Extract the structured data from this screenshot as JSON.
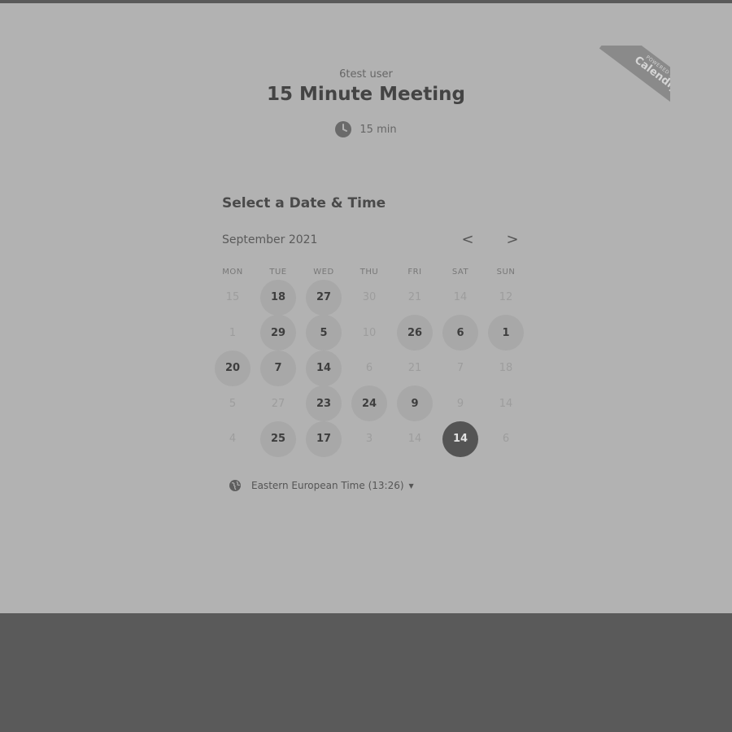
{
  "host_name": "6test user",
  "event_title": "15 Minute Meeting",
  "duration": "15 min",
  "ribbon": {
    "small": "POWERED BY",
    "brand": "Calendly"
  },
  "select_heading": "Select a Date & Time",
  "month_label": "September 2021",
  "nav": {
    "prev": "<",
    "next": ">"
  },
  "weekdays": [
    "MON",
    "TUE",
    "WED",
    "THU",
    "FRI",
    "SAT",
    "SUN"
  ],
  "weeks": [
    [
      {
        "d": "15",
        "s": "unavailable"
      },
      {
        "d": "18",
        "s": "available"
      },
      {
        "d": "27",
        "s": "available"
      },
      {
        "d": "30",
        "s": "unavailable"
      },
      {
        "d": "21",
        "s": "unavailable"
      },
      {
        "d": "14",
        "s": "unavailable"
      },
      {
        "d": "12",
        "s": "unavailable"
      }
    ],
    [
      {
        "d": "1",
        "s": "unavailable"
      },
      {
        "d": "29",
        "s": "available"
      },
      {
        "d": "5",
        "s": "available"
      },
      {
        "d": "10",
        "s": "unavailable"
      },
      {
        "d": "26",
        "s": "available"
      },
      {
        "d": "6",
        "s": "available"
      },
      {
        "d": "1",
        "s": "available"
      }
    ],
    [
      {
        "d": "20",
        "s": "available"
      },
      {
        "d": "7",
        "s": "available"
      },
      {
        "d": "14",
        "s": "available"
      },
      {
        "d": "6",
        "s": "unavailable"
      },
      {
        "d": "21",
        "s": "unavailable"
      },
      {
        "d": "7",
        "s": "unavailable"
      },
      {
        "d": "18",
        "s": "unavailable"
      }
    ],
    [
      {
        "d": "5",
        "s": "unavailable"
      },
      {
        "d": "27",
        "s": "unavailable"
      },
      {
        "d": "23",
        "s": "available"
      },
      {
        "d": "24",
        "s": "available"
      },
      {
        "d": "9",
        "s": "available"
      },
      {
        "d": "9",
        "s": "unavailable"
      },
      {
        "d": "14",
        "s": "unavailable"
      }
    ],
    [
      {
        "d": "4",
        "s": "unavailable"
      },
      {
        "d": "25",
        "s": "available"
      },
      {
        "d": "17",
        "s": "available"
      },
      {
        "d": "3",
        "s": "unavailable"
      },
      {
        "d": "14",
        "s": "unavailable"
      },
      {
        "d": "14",
        "s": "selected"
      },
      {
        "d": "6",
        "s": "unavailable"
      }
    ]
  ],
  "timezone": "Eastern European Time (13:26)",
  "colors": {
    "overlay": "#b2b2b2",
    "dark_bar": "#5a5a5a",
    "selected_day": "#545454",
    "available_day": "#a8a8a8"
  }
}
